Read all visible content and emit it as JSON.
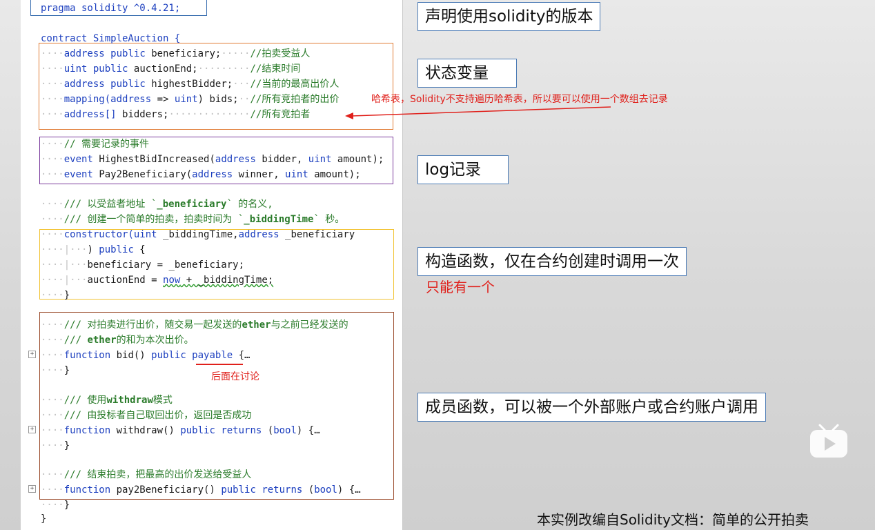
{
  "code": {
    "pragma": "pragma solidity ^0.4.21;",
    "contract_decl": "contract SimpleAuction {",
    "state_vars": [
      {
        "kw1": "address",
        "kw2": "public",
        "ident": "beneficiary;",
        "comment": "//拍卖受益人"
      },
      {
        "kw1": "uint",
        "kw2": "public",
        "ident": "auctionEnd;",
        "comment": "//结束时间"
      },
      {
        "kw1": "address",
        "kw2": "public",
        "ident": "highestBidder;",
        "comment": "//当前的最高出价人"
      },
      {
        "mapping": "mapping(",
        "kw1": "address",
        "arrow": " => ",
        "kw2": "uint",
        "ident": ") bids;",
        "comment": "//所有竞拍者的出价"
      },
      {
        "kw1": "address[]",
        "ident": "bidders;",
        "comment": "//所有竞拍者"
      }
    ],
    "event_comment": "// 需要记录的事件",
    "events": [
      {
        "kw": "event",
        "name": "HighestBidIncreased(",
        "t1": "address",
        "p1": " bidder, ",
        "t2": "uint",
        "p2": " amount);"
      },
      {
        "kw": "event",
        "name": "Pay2Beneficiary(",
        "t1": "address",
        "p1": " winner, ",
        "t2": "uint",
        "p2": " amount);"
      }
    ],
    "ctor_comment1_a": "/// 以受益者地址 `",
    "ctor_comment1_b": "_beneficiary",
    "ctor_comment1_c": "` 的名义,",
    "ctor_comment2_a": "/// 创建一个简单的拍卖，拍卖时间为 `",
    "ctor_comment2_b": "_biddingTime",
    "ctor_comment2_c": "` 秒。",
    "ctor_line1_kw": "constructor(",
    "ctor_line1_t1": "uint",
    "ctor_line1_p1": " _biddingTime,",
    "ctor_line1_t2": "address",
    "ctor_line1_p2": " _beneficiary",
    "ctor_line2_a": ") ",
    "ctor_line2_kw": "public",
    "ctor_line2_b": " {",
    "ctor_body1": "beneficiary = _beneficiary;",
    "ctor_body2_a": "auctionEnd = ",
    "ctor_body2_now": "now",
    "ctor_body2_b": " + _biddingTime;",
    "close_brace": "}",
    "bid_comment1_a": "/// 对拍卖进行出价，随交易一起发送的",
    "bid_comment1_b": "ether",
    "bid_comment1_c": "与之前已经发送的",
    "bid_comment2_a": "/// ",
    "bid_comment2_b": "ether",
    "bid_comment2_c": "的和为本次出价。",
    "bid_fn": {
      "kw": "function",
      "name": " bid() ",
      "vis": "public",
      "mod": " payable",
      "tail": " {…"
    },
    "wd_comment1_a": "/// 使用",
    "wd_comment1_b": "withdraw",
    "wd_comment1_c": "模式",
    "wd_comment2": "/// 由投标者自己取回出价，返回是否成功",
    "wd_fn": {
      "kw": "function",
      "name": " withdraw() ",
      "vis": "public",
      "ret": " returns",
      "tail1": " (",
      "type": "bool",
      "tail2": ") {…"
    },
    "pay_comment": "/// 结束拍卖，把最高的出价发送给受益人",
    "pay_fn": {
      "kw": "function",
      "name": " pay2Beneficiary() ",
      "vis": "public",
      "ret": " returns",
      "tail1": " (",
      "type": "bool",
      "tail2": ") {…"
    },
    "fold_glyph": "+"
  },
  "labels": {
    "version": "声明使用solidity的版本",
    "state": "状态变量",
    "log": "log记录",
    "constructor": "构造函数，仅在合约创建时调用一次",
    "members": "成员函数，可以被一个外部账户或合约账户调用"
  },
  "notes": {
    "hash": "哈希表，Solidity不支持遍历哈希表，所以要可以使用一个数组去记录",
    "only_one": "只能有一个",
    "discuss_later": "后面在讨论"
  },
  "footer": "本实例改编自Solidity文档：简单的公开拍卖",
  "colors": {
    "orange_box": "#e07a32",
    "purple_box": "#7a3a9c",
    "yellow_box": "#f2c230",
    "brown_box": "#9a4a2a",
    "blue_box": "#3a6fb0",
    "red": "#e0201b"
  },
  "icons": {
    "play": "play-icon",
    "fold": "expand-fold-icon"
  }
}
